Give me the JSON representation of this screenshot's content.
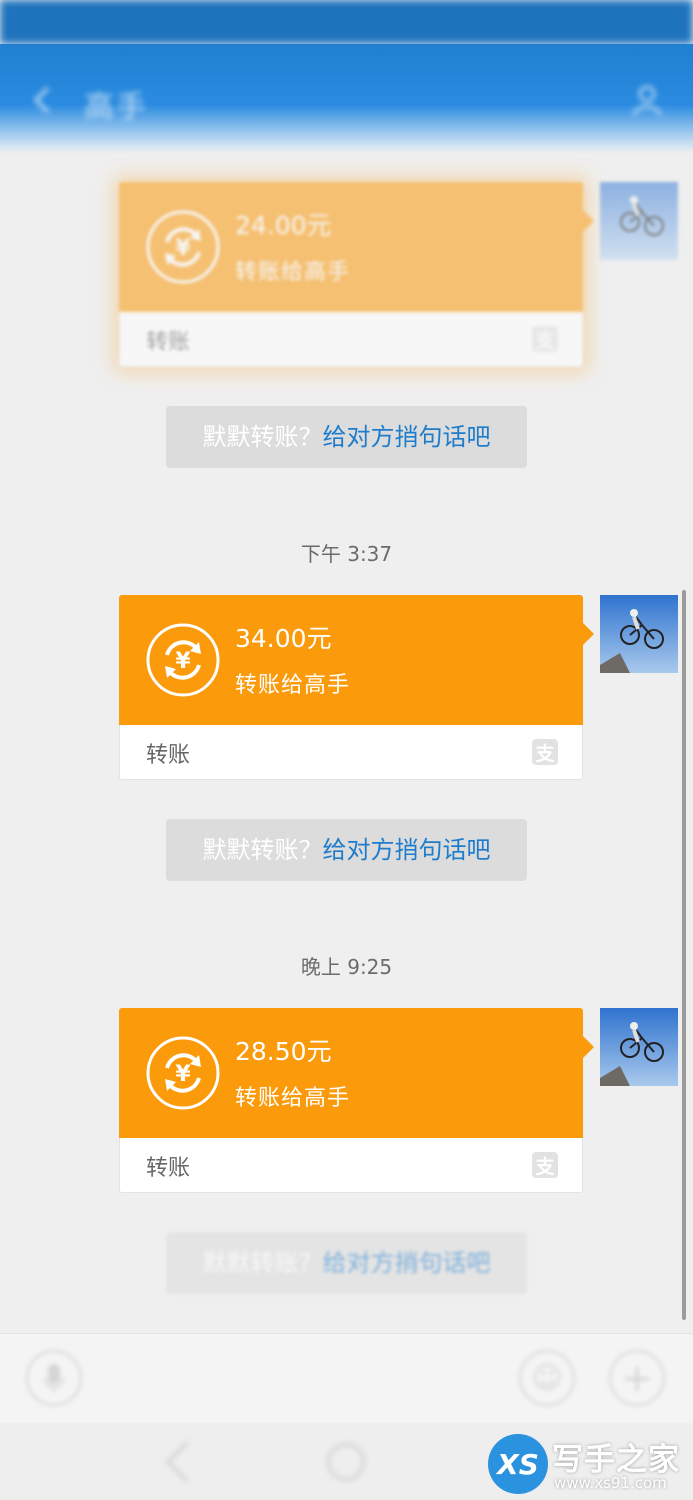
{
  "header": {
    "title": "高手"
  },
  "transfers": [
    {
      "amount": "24.00元",
      "to": "转账给高手",
      "type": "转账",
      "hint_grey": "默默转账？",
      "hint_link": "给对方捎句话吧"
    },
    {
      "amount": "34.00元",
      "to": "转账给高手",
      "type": "转账",
      "hint_grey": "默默转账？",
      "hint_link": "给对方捎句话吧"
    },
    {
      "amount": "28.50元",
      "to": "转账给高手",
      "type": "转账",
      "hint_grey": "默默转账？",
      "hint_link": "给对方捎句话吧"
    }
  ],
  "timestamps": [
    "下午 3:37",
    "晚上 9:25"
  ],
  "icons": {
    "back": "chevron-left-icon",
    "profile": "person-icon",
    "coin": "yuan-transfer-icon",
    "alipay": "alipay-icon",
    "mic": "microphone-icon",
    "emoji": "smiley-icon",
    "plus": "plus-icon"
  },
  "colors": {
    "accent": "#fb9a0b",
    "link": "#1e7ccc",
    "header": "#1f7fd0"
  },
  "watermark": {
    "logo": "XS",
    "name": "写手之家",
    "url": "www.xs91.com"
  }
}
